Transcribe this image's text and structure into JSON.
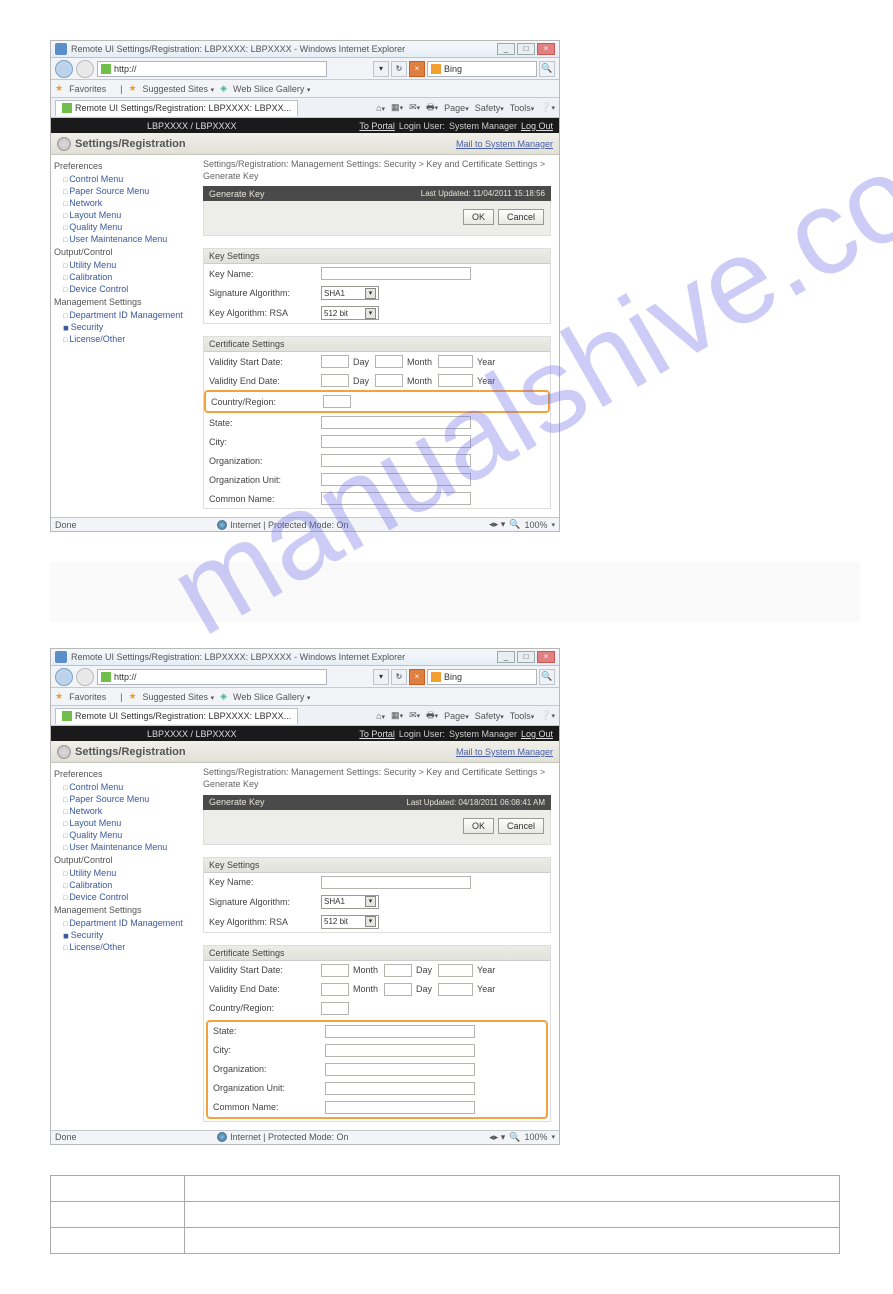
{
  "watermark": "manualshive.com",
  "ie": {
    "title": "Remote UI Settings/Registration: LBPXXXX: LBPXXXX - Windows Internet Explorer",
    "url_scheme": "http://",
    "search_text": "Bing",
    "fav_label": "Favorites",
    "suggested": "Suggested Sites",
    "slice": "Web Slice Gallery",
    "tab": "Remote UI Settings/Registration: LBPXXXX: LBPXX...",
    "menus": {
      "page": "Page",
      "safety": "Safety",
      "tools": "Tools"
    }
  },
  "header": {
    "model": "LBPXXXX / LBPXXXX",
    "portal": "To Portal",
    "login_label": "Login User:",
    "login_user": "System Manager",
    "logout": "Log Out",
    "sr": "Settings/Registration",
    "mail": "Mail to System Manager"
  },
  "sidebar": {
    "preferences": "Preferences",
    "items_pref": [
      "Control Menu",
      "Paper Source Menu",
      "Network",
      "Layout Menu",
      "Quality Menu",
      "User Maintenance Menu"
    ],
    "output": "Output/Control",
    "items_out": [
      "Utility Menu",
      "Calibration",
      "Device Control"
    ],
    "mgmt": "Management Settings",
    "items_mgmt": [
      "Department ID Management",
      "Security",
      "License/Other"
    ]
  },
  "main": {
    "crumbs": "Settings/Registration: Management Settings: Security > Key and Certificate Settings > Generate Key",
    "generate": "Generate Key",
    "updated1": "Last Updated: 11/04/2011 15:18:56",
    "updated2": "Last Updated: 04/18/2011 06:08:41 AM",
    "ok": "OK",
    "cancel": "Cancel",
    "key_settings": "Key Settings",
    "key_name": "Key Name:",
    "sig_alg": "Signature Algorithm:",
    "sig_val": "SHA1",
    "key_alg": "Key Algorithm: RSA",
    "key_alg_val": "512 bit",
    "cert_settings": "Certificate Settings",
    "vstart": "Validity Start Date:",
    "vend": "Validity End Date:",
    "day": "Day",
    "month": "Month",
    "year": "Year",
    "country": "Country/Region:",
    "state": "State:",
    "city": "City:",
    "org": "Organization:",
    "ou": "Organization Unit:",
    "cn": "Common Name:"
  },
  "status": {
    "done": "Done",
    "mode": "Internet | Protected Mode: On",
    "zoom": "100%"
  }
}
